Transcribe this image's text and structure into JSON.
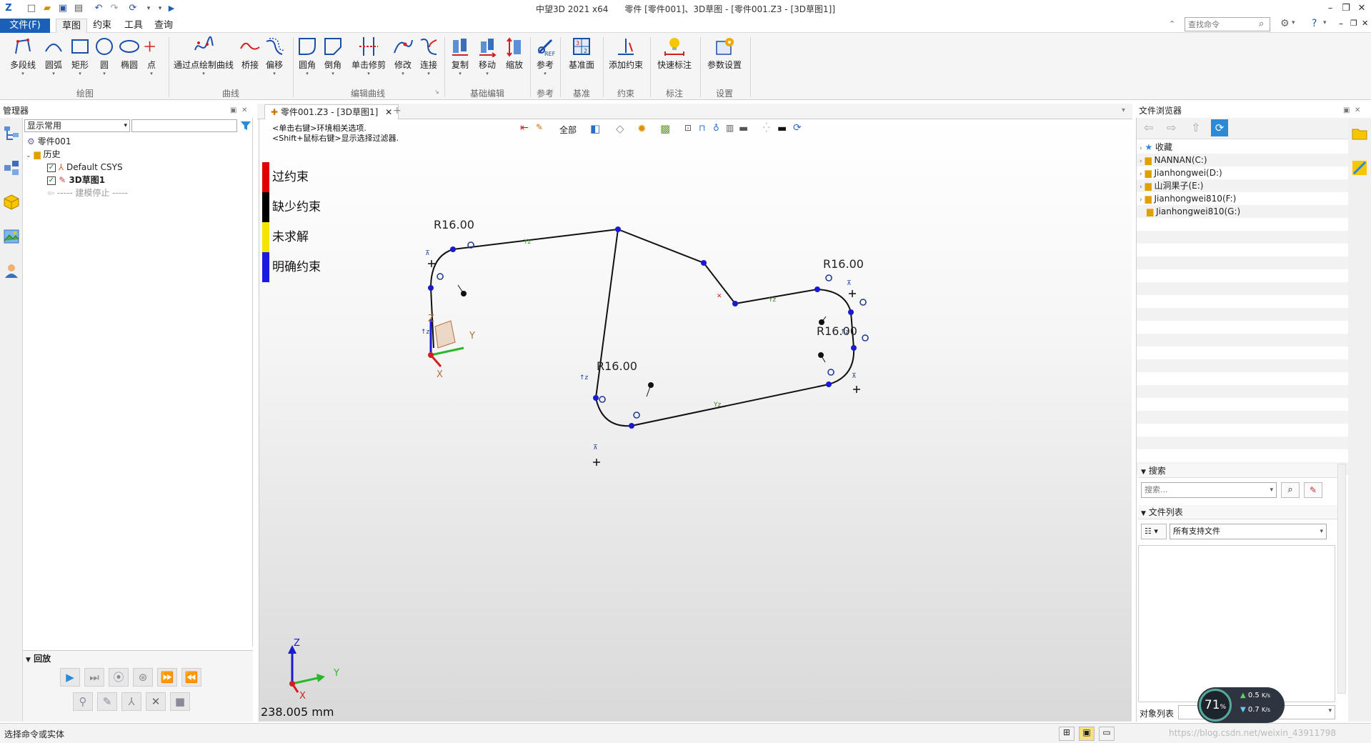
{
  "window": {
    "app_title": "中望3D 2021 x64",
    "doc_title": "零件 [零件001]、3D草图 - [零件001.Z3 - [3D草图1]]"
  },
  "menu": {
    "file": "文件(F)",
    "tabs": [
      "草图",
      "约束",
      "工具",
      "查询"
    ]
  },
  "search_command": {
    "placeholder": "查找命令"
  },
  "ribbon": {
    "groups": [
      {
        "label": "绘图",
        "buttons": [
          "多段线",
          "圆弧",
          "矩形",
          "圆",
          "椭圆",
          "点"
        ]
      },
      {
        "label": "曲线",
        "buttons": [
          "通过点绘制曲线",
          "桥接",
          "偏移"
        ]
      },
      {
        "label": "编辑曲线",
        "buttons": [
          "圆角",
          "倒角",
          "单击修剪",
          "修改",
          "连接"
        ]
      },
      {
        "label": "基础编辑",
        "buttons": [
          "复制",
          "移动",
          "缩放"
        ]
      },
      {
        "label": "参考",
        "buttons": [
          "参考"
        ]
      },
      {
        "label": "基准",
        "buttons": [
          "基准面"
        ]
      },
      {
        "label": "约束",
        "buttons": [
          "添加约束"
        ]
      },
      {
        "label": "标注",
        "buttons": [
          "快速标注"
        ]
      },
      {
        "label": "设置",
        "buttons": [
          "参数设置"
        ]
      }
    ]
  },
  "manager": {
    "title": "管理器",
    "filter_value": "显示常用",
    "tree": [
      {
        "label": "零件001"
      },
      {
        "label": "历史"
      },
      {
        "label": "Default CSYS"
      },
      {
        "label": "3D草图1"
      },
      {
        "label": "----- 建模停止 -----"
      }
    ]
  },
  "playback": {
    "title": "回放"
  },
  "document_tab": {
    "label": "零件001.Z3 - [3D草图1]"
  },
  "viewport": {
    "hint_line1": "<单击右键>环境相关选项.",
    "hint_line2": "<Shift+鼠标右键>显示选择过滤器.",
    "filter_all": "全部",
    "legend": [
      {
        "label": "过约束",
        "color": "#e00000"
      },
      {
        "label": "缺少约束",
        "color": "#000000"
      },
      {
        "label": "未求解",
        "color": "#f5e400"
      },
      {
        "label": "明确约束",
        "color": "#1a1ae0"
      }
    ],
    "dimensions": [
      "R16.00",
      "R16.00",
      "R16.00",
      "R16.00"
    ],
    "scale_text": "238.005 mm",
    "axis_labels": {
      "x": "X",
      "y": "Y",
      "z": "Z"
    }
  },
  "file_browser": {
    "title": "文件浏览器",
    "tree": [
      "收藏",
      "NANNAN(C:)",
      "Jianhongwei(D:)",
      "山洞果子(E:)",
      "Jianhongwei810(F:)",
      "Jianhongwei810(G:)"
    ],
    "search_section": "搜索",
    "search_placeholder": "搜索...",
    "file_list_section": "文件列表",
    "file_type": "所有支持文件",
    "object_list_label": "对象列表"
  },
  "status": {
    "left_text": "选择命令或实体",
    "url_text": "https://blog.csdn.net/weixin_43911798"
  },
  "net_widget": {
    "percent": "71",
    "unit": "%",
    "up": "0.5",
    "down": "0.7",
    "rate_unit": "K/s"
  }
}
